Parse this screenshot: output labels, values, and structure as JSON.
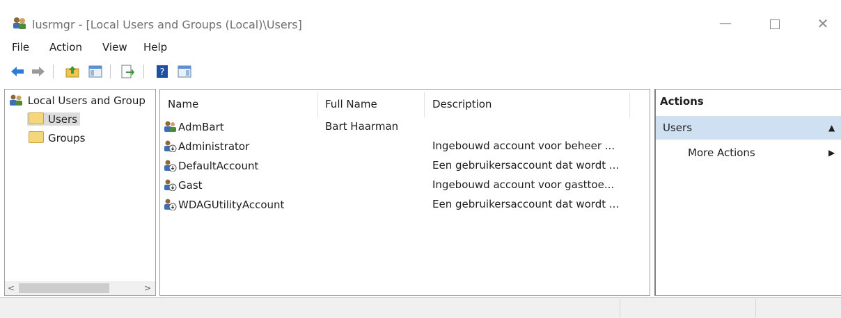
{
  "window": {
    "title": "lusrmgr - [Local Users and Groups (Local)\\Users]",
    "minimize": "—",
    "close": "✕"
  },
  "menu": [
    "File",
    "Action",
    "View",
    "Help"
  ],
  "tree": {
    "root": "Local Users and Group",
    "items": [
      "Users",
      "Groups"
    ],
    "selected": "Users"
  },
  "list": {
    "columns": [
      "Name",
      "Full Name",
      "Description"
    ],
    "rows": [
      {
        "name": "AdmBart",
        "full_name": "Bart Haarman",
        "description": ""
      },
      {
        "name": "Administrator",
        "full_name": "",
        "description": "Ingebouwd account voor beheer ..."
      },
      {
        "name": "DefaultAccount",
        "full_name": "",
        "description": "Een gebruikersaccount dat wordt ..."
      },
      {
        "name": "Gast",
        "full_name": "",
        "description": "Ingebouwd account voor gasttoe..."
      },
      {
        "name": "WDAGUtilityAccount",
        "full_name": "",
        "description": "Een gebruikersaccount dat wordt ..."
      }
    ]
  },
  "actions": {
    "header": "Actions",
    "section": "Users",
    "more": "More Actions"
  },
  "icons": {
    "back": "back-arrow-icon",
    "forward": "forward-arrow-icon",
    "up": "up-folder-icon",
    "show_hide_tree": "console-tree-icon",
    "export": "export-list-icon",
    "help": "help-icon",
    "action_pane": "action-pane-icon"
  },
  "colors": {
    "action_bar": "#cfe0f2",
    "selection": "#dcdcdc",
    "toolbar_blue": "#2f7cd3"
  }
}
